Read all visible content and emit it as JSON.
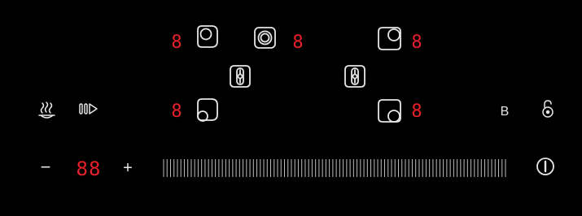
{
  "panel": {
    "zones": [
      {
        "id": "rear-left",
        "level": "8"
      },
      {
        "id": "rear-center",
        "level": "8"
      },
      {
        "id": "rear-right",
        "level": "8"
      },
      {
        "id": "front-left",
        "level": "8"
      },
      {
        "id": "front-right",
        "level": "8"
      }
    ],
    "bridge_icons": [
      "bridge-left-icon",
      "bridge-right-icon"
    ],
    "keep_warm_icon": "keep-warm-icon",
    "pause_icon": "pause-play-icon",
    "boost_label": "B",
    "lock_icon": "lock-icon",
    "timer": {
      "minus": "−",
      "plus": "+",
      "value": "88"
    },
    "slider": {
      "ticks": 100,
      "level": 0
    },
    "power_icon": "power-icon",
    "colors": {
      "background": "#000000",
      "icon": "#e6e6e6",
      "digit": "#e8202b",
      "slider": "#bdbdbd"
    }
  }
}
